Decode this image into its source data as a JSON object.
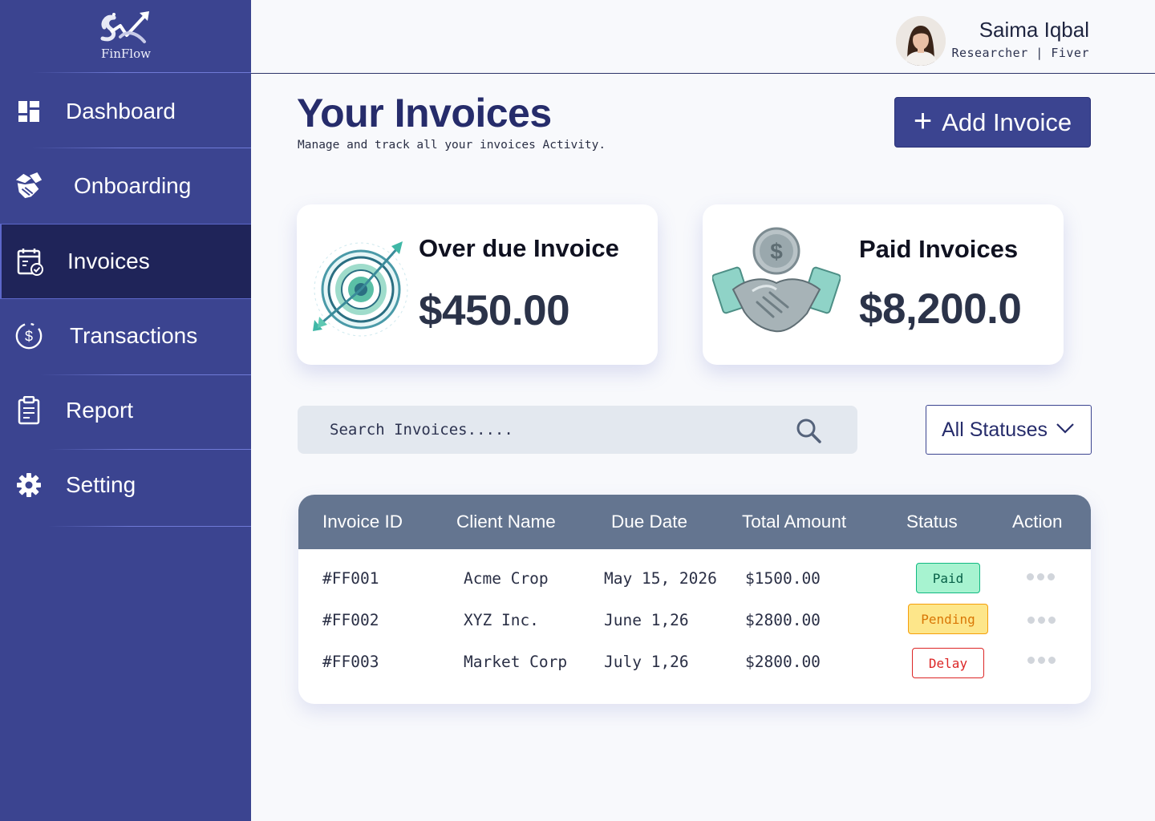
{
  "brand": {
    "name": "FinFlow"
  },
  "sidebar": {
    "items": [
      {
        "label": "Dashboard",
        "icon": "dashboard-icon"
      },
      {
        "label": "Onboarding",
        "icon": "handshake-icon"
      },
      {
        "label": "Invoices",
        "icon": "invoice-calendar-icon",
        "active": true
      },
      {
        "label": "Transactions",
        "icon": "dollar-circle-icon"
      },
      {
        "label": "Report",
        "icon": "clipboard-icon"
      },
      {
        "label": "Setting",
        "icon": "gear-icon"
      }
    ]
  },
  "user": {
    "name": "Saima Iqbal",
    "role": "Researcher | Fiver"
  },
  "page": {
    "title": "Your Invoices",
    "subtitle": "Manage and track all your invoices Activity.",
    "add_button_label": "Add Invoice"
  },
  "cards": {
    "overdue": {
      "title": "Over due Invoice",
      "value": "$450.00"
    },
    "paid": {
      "title": "Paid Invoices",
      "value": "$8,200.0"
    }
  },
  "search": {
    "placeholder": "Search Invoices....."
  },
  "status_filter": {
    "selected": "All Statuses"
  },
  "table": {
    "headers": [
      "Invoice ID",
      "Client Name",
      "Due Date",
      "Total Amount",
      "Status",
      "Action"
    ],
    "rows": [
      {
        "id": "#FF001",
        "client": "Acme Crop",
        "due": "May 15, 2026",
        "amount": "$1500.00",
        "status": "Paid"
      },
      {
        "id": "#FF002",
        "client": "XYZ Inc.",
        "due": "June 1,26",
        "amount": "$2800.00",
        "status": "Pending"
      },
      {
        "id": "#FF003",
        "client": "Market Corp",
        "due": "July 1,26",
        "amount": "$2800.00",
        "status": "Delay"
      }
    ]
  },
  "colors": {
    "sidebar": "#3b4490",
    "sidebar_active": "#1f2459",
    "table_header": "#647590",
    "status_paid": "#a7f3d0",
    "status_pending": "#fde68a",
    "status_delay": "#dc2626"
  }
}
